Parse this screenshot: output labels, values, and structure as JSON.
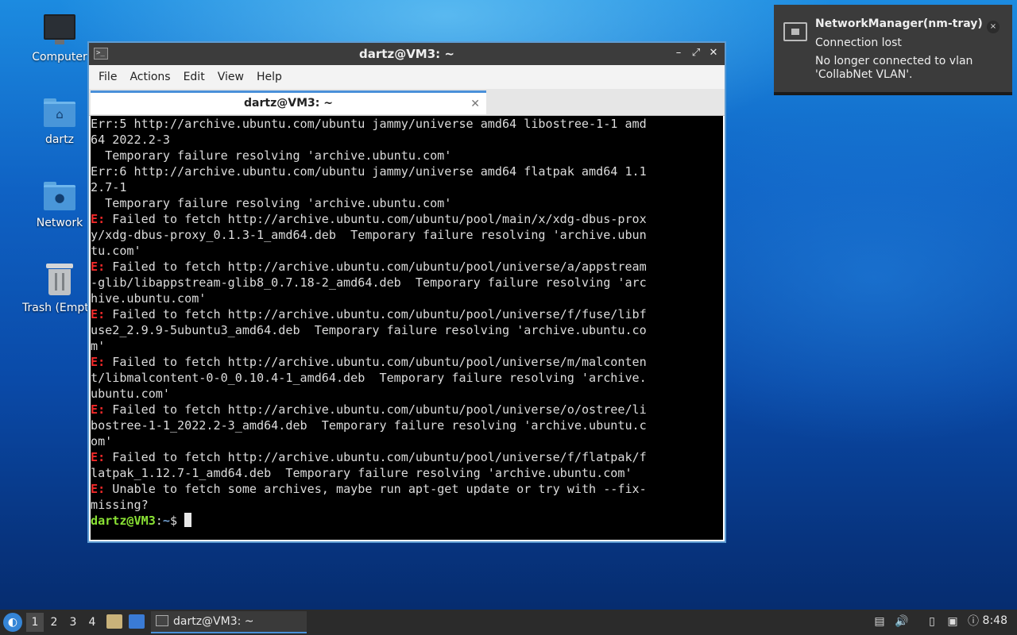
{
  "desktop": {
    "icons": [
      {
        "label": "Computer",
        "icon": "computer-icon"
      },
      {
        "label": "dartz",
        "icon": "home-folder-icon"
      },
      {
        "label": "Network",
        "icon": "network-folder-icon"
      },
      {
        "label": "Trash (Empt",
        "icon": "trash-icon"
      }
    ]
  },
  "window": {
    "title": "dartz@VM3: ~",
    "menu": [
      "File",
      "Actions",
      "Edit",
      "View",
      "Help"
    ],
    "tab_label": "dartz@VM3: ~",
    "tab_close": "✕",
    "terminal_lines": [
      "Err:5 http://archive.ubuntu.com/ubuntu jammy/universe amd64 libostree-1-1 amd",
      "64 2022.2-3",
      "  Temporary failure resolving 'archive.ubuntu.com'",
      "Err:6 http://archive.ubuntu.com/ubuntu jammy/universe amd64 flatpak amd64 1.1",
      "2.7-1",
      "  Temporary failure resolving 'archive.ubuntu.com'",
      "E: Failed to fetch http://archive.ubuntu.com/ubuntu/pool/main/x/xdg-dbus-prox",
      "y/xdg-dbus-proxy_0.1.3-1_amd64.deb  Temporary failure resolving 'archive.ubun",
      "tu.com'",
      "E: Failed to fetch http://archive.ubuntu.com/ubuntu/pool/universe/a/appstream",
      "-glib/libappstream-glib8_0.7.18-2_amd64.deb  Temporary failure resolving 'arc",
      "hive.ubuntu.com'",
      "E: Failed to fetch http://archive.ubuntu.com/ubuntu/pool/universe/f/fuse/libf",
      "use2_2.9.9-5ubuntu3_amd64.deb  Temporary failure resolving 'archive.ubuntu.co",
      "m'",
      "E: Failed to fetch http://archive.ubuntu.com/ubuntu/pool/universe/m/malconten",
      "t/libmalcontent-0-0_0.10.4-1_amd64.deb  Temporary failure resolving 'archive.",
      "ubuntu.com'",
      "E: Failed to fetch http://archive.ubuntu.com/ubuntu/pool/universe/o/ostree/li",
      "bostree-1-1_2022.2-3_amd64.deb  Temporary failure resolving 'archive.ubuntu.c",
      "om'",
      "E: Failed to fetch http://archive.ubuntu.com/ubuntu/pool/universe/f/flatpak/f",
      "latpak_1.12.7-1_amd64.deb  Temporary failure resolving 'archive.ubuntu.com'",
      "E: Unable to fetch some archives, maybe run apt-get update or try with --fix-",
      "missing?"
    ],
    "prompt": {
      "user": "dartz@VM3",
      "sep": ":",
      "path": "~",
      "symbol": "$ "
    }
  },
  "notification": {
    "app": "NetworkManager(nm-tray)",
    "summary": "Connection lost",
    "body": "No longer connected to vlan 'CollabNet VLAN'.",
    "close": "×"
  },
  "taskbar": {
    "workspaces": [
      "1",
      "2",
      "3",
      "4"
    ],
    "active_workspace": "1",
    "task_label": "dartz@VM3: ~",
    "clock": "8:48"
  },
  "colors": {
    "accent": "#4a90d9",
    "error_prefix": "#ef2929",
    "prompt_user": "#8ae234",
    "prompt_path": "#729fcf"
  }
}
